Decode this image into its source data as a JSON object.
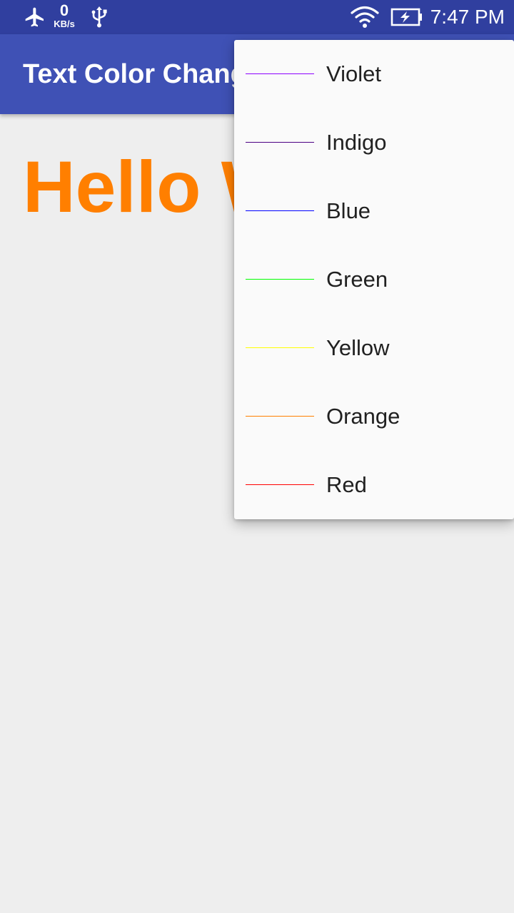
{
  "status_bar": {
    "netspeed_value": "0",
    "netspeed_unit": "KB/s",
    "time": "7:47 PM",
    "icons": [
      "airplane-mode-icon",
      "usb-icon",
      "wifi-icon",
      "battery-charging-icon"
    ]
  },
  "app_bar": {
    "title": "Text Color Changer"
  },
  "content": {
    "hello_text": "Hello World!",
    "hello_color": "#ff7f00"
  },
  "menu": {
    "items": [
      {
        "label": "Violet",
        "color": "#8b00ff"
      },
      {
        "label": "Indigo",
        "color": "#4b0082"
      },
      {
        "label": "Blue",
        "color": "#0000ff"
      },
      {
        "label": "Green",
        "color": "#00ff00"
      },
      {
        "label": "Yellow",
        "color": "#ffff00"
      },
      {
        "label": "Orange",
        "color": "#ff7f00"
      },
      {
        "label": "Red",
        "color": "#ff0000"
      }
    ]
  },
  "colors": {
    "status_bar": "#303f9f",
    "app_bar": "#3f51b5",
    "background": "#eeeeee",
    "menu_background": "#fafafa"
  }
}
